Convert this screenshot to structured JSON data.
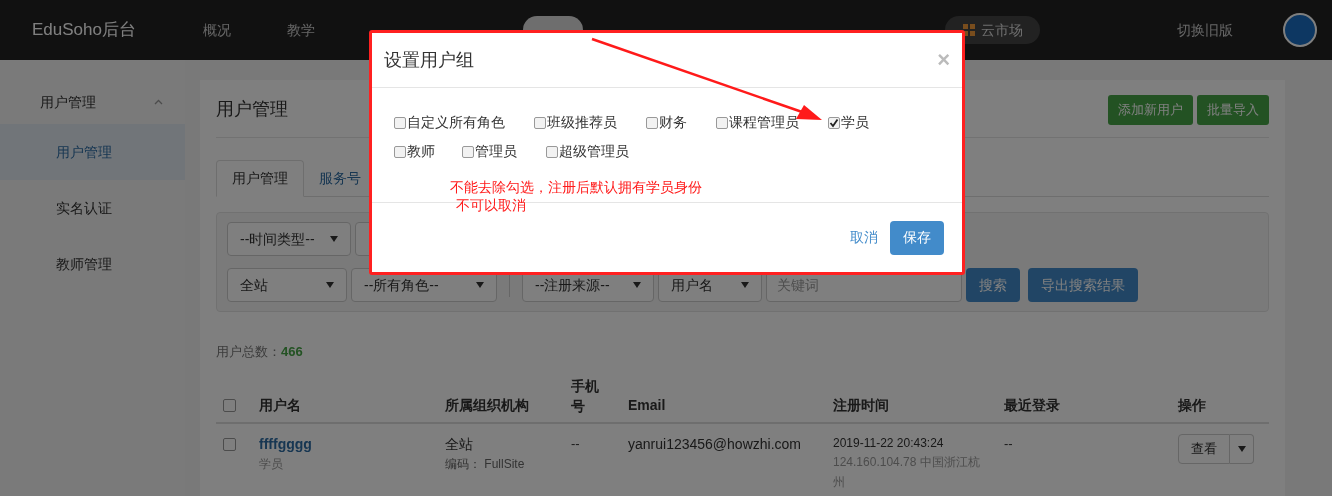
{
  "topbar": {
    "brand": "EduSoho后台",
    "nav": [
      {
        "label": "概况",
        "selected": false
      },
      {
        "label": "教学",
        "selected": false
      },
      {
        "selected": false
      },
      {
        "selected": false
      },
      {
        "selected": true
      },
      {
        "selected": false
      },
      {
        "selected": false
      },
      {
        "selected": false
      }
    ],
    "market": "云市场",
    "switch_link": "切换旧版"
  },
  "sidebar": {
    "group": {
      "label": "用户管理",
      "expanded": true
    },
    "items": [
      {
        "label": "用户管理",
        "selected": true
      },
      {
        "label": "实名认证",
        "selected": false
      },
      {
        "label": "教师管理",
        "selected": false
      }
    ]
  },
  "content": {
    "title": "用户管理",
    "buttons": [
      "添加新用户",
      "批量导入"
    ],
    "tabs": [
      {
        "label": "用户管理",
        "selected": true
      },
      {
        "label": "服务号",
        "selected": false
      }
    ],
    "filters_row_1": [
      "--时间类型--"
    ],
    "filters_row_2": [
      "全站",
      "--所有角色--",
      "--注册来源--",
      "用户名"
    ],
    "keyword": {
      "placeholder": "关键词"
    },
    "search_button": "搜索",
    "export_button": "导出搜索结果",
    "total_label": "用户总数：",
    "total": "466",
    "table": {
      "select_all_checked": false,
      "columns": [
        "用户名",
        "所属组织机构",
        "手机号",
        "Email",
        "注册时间",
        "最近登录",
        "操作"
      ],
      "rows": [
        {
          "checked": false,
          "username": "ffffgggg",
          "role": "学员",
          "org": "全站",
          "org_code": "编码： FullSite",
          "phone": "--",
          "email": "yanrui123456@howzhi.com",
          "registered": "2019-11-22 20:43:24",
          "ip": "124.160.104.78 中国浙江杭州",
          "last_login": "--",
          "action": "查看"
        }
      ]
    }
  },
  "modal": {
    "title": "设置用户组",
    "close": "×",
    "options": [
      {
        "label": "自定义所有角色",
        "checked": false
      },
      {
        "label": "班级推荐员",
        "checked": false
      },
      {
        "label": "财务",
        "checked": false
      },
      {
        "label": "课程管理员",
        "checked": false
      },
      {
        "label": "学员",
        "checked": true
      },
      {
        "label": "教师",
        "checked": false
      },
      {
        "label": "管理员",
        "checked": false
      },
      {
        "label": "超级管理员",
        "checked": false
      }
    ],
    "note": [
      "不能去除勾选，注册后默认拥有学员身份",
      "不可以取消"
    ],
    "cancel": "取消",
    "save": "保存"
  }
}
